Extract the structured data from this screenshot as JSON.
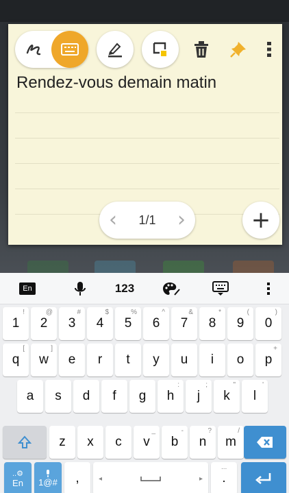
{
  "note": {
    "text": "Rendez-vous demain matin",
    "page_indicator": "1/1",
    "toolbar": {
      "handwriting_icon": "handwriting-icon",
      "keyboard_icon": "keyboard-icon",
      "highlighter_icon": "highlighter-icon",
      "note_color_icon": "note-color-icon",
      "delete_icon": "trash-icon",
      "pin_icon": "pin-icon",
      "more_icon": "more-vertical-icon",
      "accent_color": "#efa72a"
    }
  },
  "keyboard": {
    "top_bar": {
      "lang": "En",
      "numbers": "123"
    },
    "rows": {
      "numbers": [
        {
          "main": "1",
          "sub": "!"
        },
        {
          "main": "2",
          "sub": "@"
        },
        {
          "main": "3",
          "sub": "#"
        },
        {
          "main": "4",
          "sub": "$"
        },
        {
          "main": "5",
          "sub": "%"
        },
        {
          "main": "6",
          "sub": "^"
        },
        {
          "main": "7",
          "sub": "&"
        },
        {
          "main": "8",
          "sub": "*"
        },
        {
          "main": "9",
          "sub": "("
        },
        {
          "main": "0",
          "sub": ")"
        }
      ],
      "row1": [
        {
          "main": "q",
          "sub": "["
        },
        {
          "main": "w",
          "sub": "]"
        },
        {
          "main": "e",
          "sub": ""
        },
        {
          "main": "r",
          "sub": ""
        },
        {
          "main": "t",
          "sub": ""
        },
        {
          "main": "y",
          "sub": ""
        },
        {
          "main": "u",
          "sub": ""
        },
        {
          "main": "i",
          "sub": ""
        },
        {
          "main": "o",
          "sub": ""
        },
        {
          "main": "p",
          "sub": "+"
        }
      ],
      "row2": [
        {
          "main": "a",
          "sub": ""
        },
        {
          "main": "s",
          "sub": ""
        },
        {
          "main": "d",
          "sub": ""
        },
        {
          "main": "f",
          "sub": ""
        },
        {
          "main": "g",
          "sub": ""
        },
        {
          "main": "h",
          "sub": ":"
        },
        {
          "main": "j",
          "sub": ";"
        },
        {
          "main": "k",
          "sub": "\""
        },
        {
          "main": "l",
          "sub": "'"
        }
      ],
      "row3": [
        {
          "main": "z",
          "sub": ""
        },
        {
          "main": "x",
          "sub": ""
        },
        {
          "main": "c",
          "sub": ""
        },
        {
          "main": "v",
          "sub": "_"
        },
        {
          "main": "b",
          "sub": "-"
        },
        {
          "main": "n",
          "sub": "?"
        },
        {
          "main": "m",
          "sub": "/"
        }
      ]
    },
    "bottom": {
      "lang_key": "En",
      "lang_key_sub": "..⚙",
      "symbols_key": "1@#",
      "comma": ",",
      "period": ".",
      "period_sub": "..."
    },
    "colors": {
      "action_blue": "#3f8fd0"
    }
  }
}
